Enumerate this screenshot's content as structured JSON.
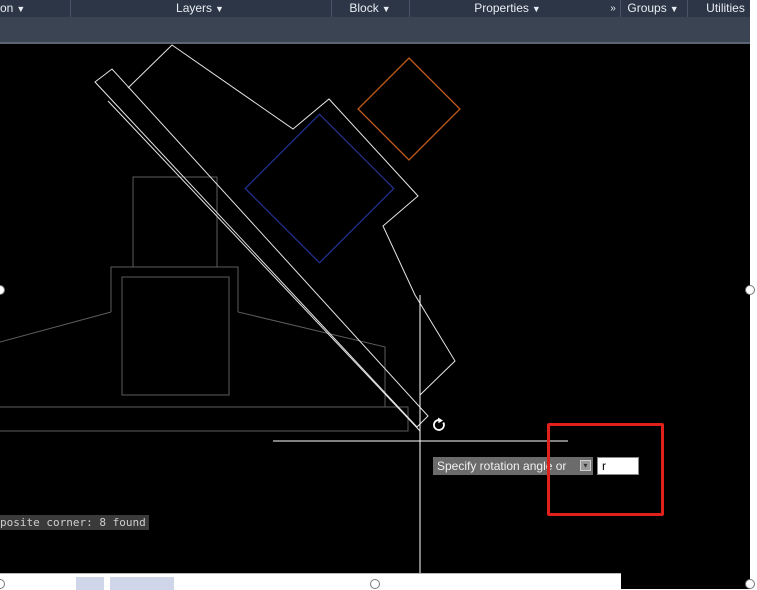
{
  "ribbon": {
    "panels": [
      {
        "label": "on"
      },
      {
        "label": "Layers"
      },
      {
        "label": "Block"
      },
      {
        "label": "Properties"
      },
      {
        "label": "Groups"
      },
      {
        "label": "Utilities"
      }
    ],
    "expand_glyph": "»"
  },
  "canvas": {
    "background": "#000000",
    "geometry_colors": {
      "default": "#ffffff",
      "blue_block": "#23308c",
      "orange_block": "#c05a1c",
      "faint": "#5c5c5c"
    }
  },
  "rotate_prompt": {
    "label": "Specify rotation angle or",
    "options_icon": "options-down-icon",
    "input_value": "r"
  },
  "command_history": {
    "text": "posite corner: 8 found"
  },
  "annotation": {
    "color": "#e0201a"
  }
}
